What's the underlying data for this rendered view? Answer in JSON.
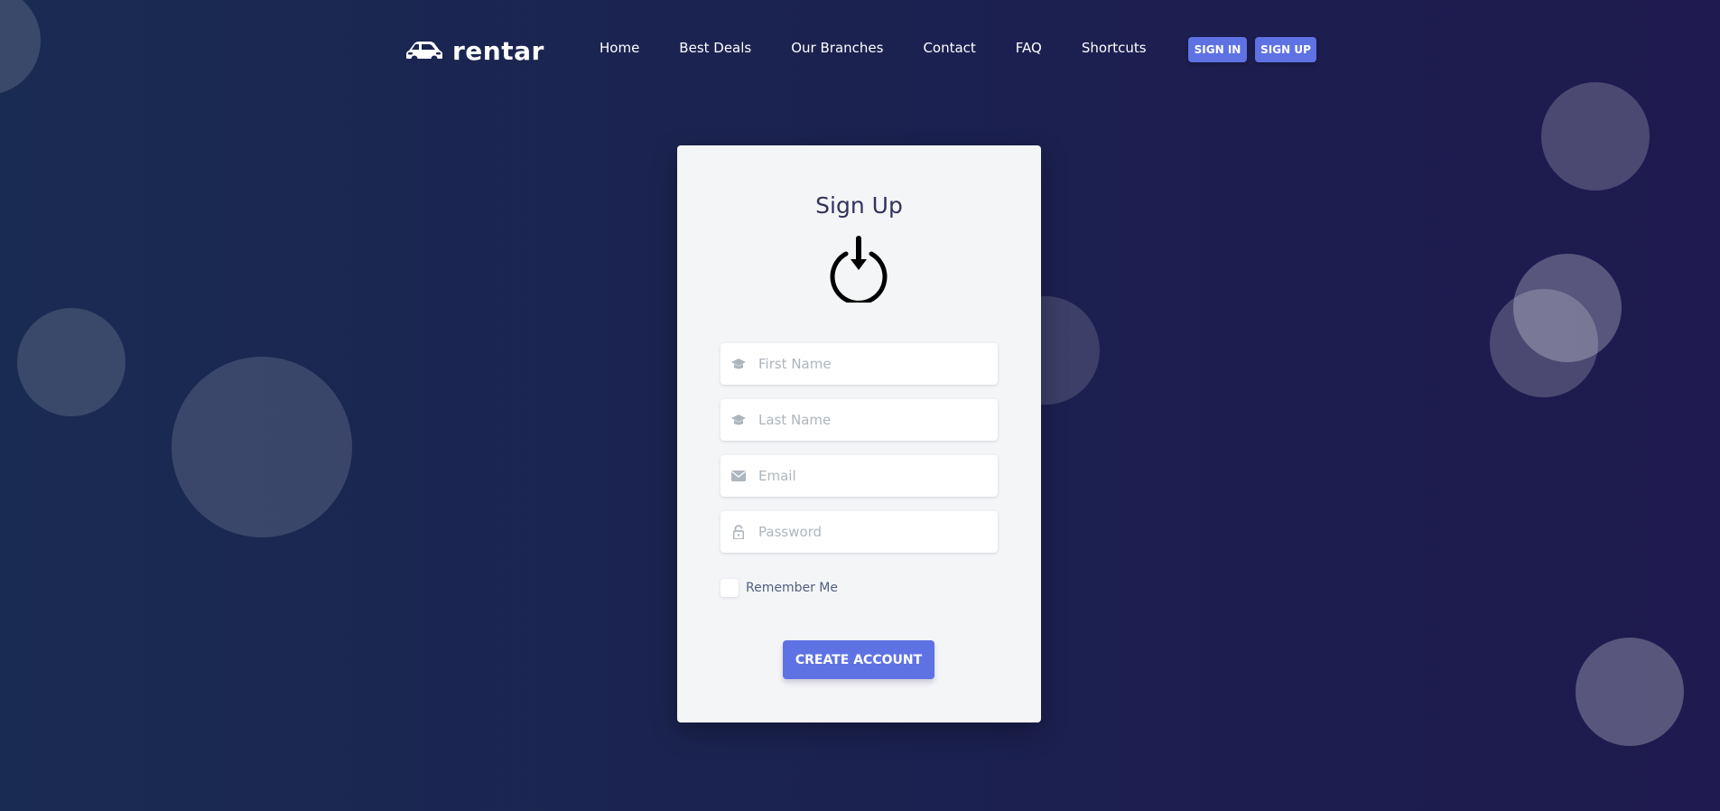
{
  "brand": {
    "name": "rentar",
    "logo_icon": "car-icon"
  },
  "nav": {
    "links": [
      "Home",
      "Best Deals",
      "Our Branches",
      "Contact",
      "FAQ",
      "Shortcuts"
    ],
    "sign_in": "SIGN IN",
    "sign_up": "SIGN UP"
  },
  "form": {
    "title": "Sign Up",
    "icon": "power-download-icon",
    "first_name_placeholder": "First Name",
    "last_name_placeholder": "Last Name",
    "email_placeholder": "Email",
    "password_placeholder": "Password",
    "remember_label": "Remember Me",
    "remember_checked": false,
    "submit_label": "CREATE ACCOUNT"
  },
  "colors": {
    "accent": "#5e72e4",
    "background_start": "#1a2b52",
    "background_end": "#1f1a4f",
    "card": "#f4f5f7"
  }
}
